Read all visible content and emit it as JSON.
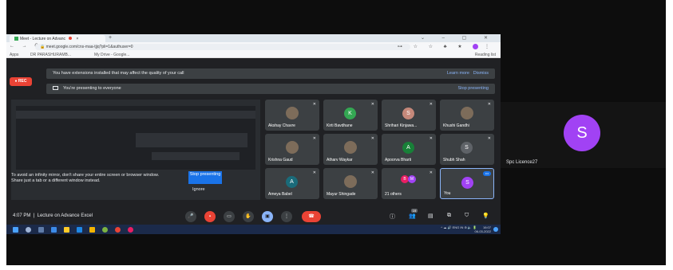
{
  "browser": {
    "tab_title": "Meet - Lecture on Advanc",
    "close": "×",
    "new_tab": "+",
    "window_controls": "⌄ – ▢ ✕",
    "nav": "← → C",
    "url": "meet.google.com/cns-maa-tjjq?pli=1&authuser=0",
    "url_icons": "⊶ ☆ ☆ ♣ ★",
    "bookmarks": {
      "apps": "Apps",
      "item1": "DR PARASHURAMB...",
      "item2": "My Drive - Google...",
      "reading_list": "Reading list"
    }
  },
  "meet": {
    "rec_label": "REC",
    "extension_banner": {
      "text": "You have extensions installed that may affect the quality of your call",
      "learn_more": "Learn more",
      "dismiss": "Dismiss"
    },
    "presenting_banner": {
      "text": "You're presenting to everyone",
      "stop": "Stop presenting"
    },
    "presentation": {
      "warning": "To avoid an infinity mirror, don't share your entire screen or browser window. Share just a tab or a different window instead.",
      "stop_button": "Stop presenting",
      "ignore": "Ignore"
    },
    "participants": [
      {
        "name": "Akshay Chavre",
        "initial": "",
        "color": "#3c4043"
      },
      {
        "name": "Kirti Bavdhane",
        "initial": "K",
        "color": "#34a853"
      },
      {
        "name": "Shrihari Kinjawa...",
        "initial": "S",
        "color": "#c5887a"
      },
      {
        "name": "Khushi Gandhi",
        "initial": "",
        "color": "#3c4043"
      },
      {
        "name": "Krishna Gaud",
        "initial": "",
        "color": "#3c4043"
      },
      {
        "name": "Atharv Waykar",
        "initial": "",
        "color": "#3c4043"
      },
      {
        "name": "Apoorva Bharti",
        "initial": "A",
        "color": "#188038"
      },
      {
        "name": "Shubh Shah",
        "initial": "S",
        "color": "#5f6368"
      },
      {
        "name": "Ameya Babel",
        "initial": "A",
        "color": "#1a6b7a"
      },
      {
        "name": "Mayur Shingade",
        "initial": "",
        "color": "#3c4043"
      },
      {
        "name": "21 others",
        "initial": "",
        "color": "#3c4043"
      },
      {
        "name": "You",
        "initial": "S",
        "color": "#a142f4"
      }
    ],
    "others_initials": [
      "B",
      "M"
    ],
    "more_options": "•••",
    "control_bar": {
      "time": "4:07 PM",
      "separator": "|",
      "meeting_name": "Lecture on Advance Excel",
      "participant_count": "19"
    }
  },
  "taskbar": {
    "tray_text": "ENG IN",
    "time": "16:07",
    "date": "06-03-2022"
  },
  "right_tile": {
    "initial": "S",
    "name": "Spc Licence27"
  }
}
